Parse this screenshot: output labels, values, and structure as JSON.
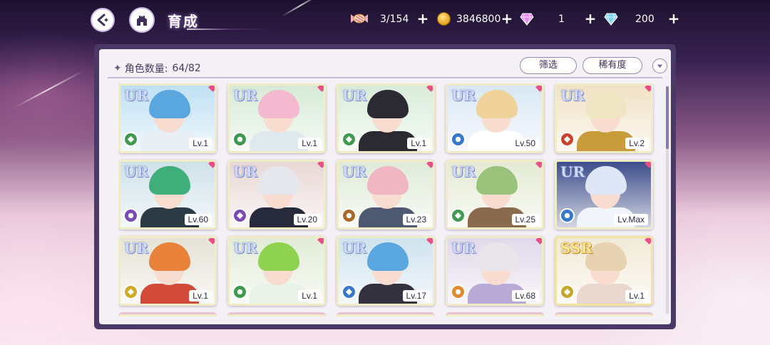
{
  "header": {
    "title": "育成",
    "resources": [
      {
        "name": "candy",
        "value": "3/154"
      },
      {
        "name": "coin",
        "value": "3846800"
      },
      {
        "name": "pink-gem",
        "value": "1"
      },
      {
        "name": "blue-gem",
        "value": "200"
      }
    ]
  },
  "panel": {
    "count_label": "角色数量:",
    "count_value": "64/82",
    "filter_label": "筛选",
    "sort_label": "稀有度"
  },
  "cards": [
    {
      "rarity": "UR",
      "level": "Lv.1",
      "hair": "#5aa7e0",
      "bg": "#bfe0f2",
      "body": "#e8eef4",
      "attr": "#3f9a4f"
    },
    {
      "rarity": "UR",
      "level": "Lv.1",
      "hair": "#f2b9cf",
      "bg": "#d6ead6",
      "body": "#dfe9ee",
      "attr": "#3f9a4f"
    },
    {
      "rarity": "UR",
      "level": "Lv.1",
      "hair": "#2b2a33",
      "bg": "#d8ecd9",
      "body": "#2a2a30",
      "attr": "#3f9a4f"
    },
    {
      "rarity": "UR",
      "level": "Lv.50",
      "hair": "#efd39a",
      "bg": "#d9e7f3",
      "body": "#ffffff",
      "attr": "#3678c9"
    },
    {
      "rarity": "UR",
      "level": "Lv.2",
      "hair": "#efe6c4",
      "bg": "#f1e2c6",
      "body": "#c99c3b",
      "attr": "#c8442f"
    },
    {
      "rarity": "UR",
      "level": "Lv.60",
      "hair": "#3fae7a",
      "bg": "#cfe1e8",
      "body": "#2c3a45",
      "attr": "#7a4bb4"
    },
    {
      "rarity": "UR",
      "level": "Lv.20",
      "hair": "#e6e7ec",
      "bg": "#e8d8d6",
      "body": "#272a3a",
      "attr": "#7a4bb4"
    },
    {
      "rarity": "UR",
      "level": "Lv.23",
      "hair": "#f0b7c3",
      "bg": "#dfead8",
      "body": "#4e5870",
      "attr": "#a8692c"
    },
    {
      "rarity": "UR",
      "level": "Lv.25",
      "hair": "#9ac27a",
      "bg": "#e5ead4",
      "body": "#8a6a4c",
      "attr": "#3f9a4f"
    },
    {
      "rarity": "UR",
      "level": "Lv.Max",
      "hair": "#dfe6f5",
      "bg": "#3c4c8a",
      "body": "#f2f4fb",
      "attr": "#3678c9"
    },
    {
      "rarity": "UR",
      "level": "Lv.1",
      "hair": "#e9823a",
      "bg": "#e5e3d6",
      "body": "#d24a3a",
      "attr": "#d1a828"
    },
    {
      "rarity": "UR",
      "level": "Lv.1",
      "hair": "#8fd24f",
      "bg": "#e2ecd7",
      "body": "#e9f2e6",
      "attr": "#3f9a4f"
    },
    {
      "rarity": "UR",
      "level": "Lv.17",
      "hair": "#5aa7e0",
      "bg": "#cfe3ee",
      "body": "#34323f",
      "attr": "#3678c9"
    },
    {
      "rarity": "UR",
      "level": "Lv.68",
      "hair": "#e8e6ea",
      "bg": "#e0d9ea",
      "body": "#b9a9d6",
      "attr": "#e08a2b"
    },
    {
      "rarity": "SSR",
      "level": "Lv.1",
      "hair": "#e7d2b2",
      "bg": "#f1ead7",
      "body": "#e9d7cf",
      "attr": "#c6a62a"
    }
  ],
  "colors": {
    "panel_frame": "#4a3966",
    "panel_bg": "#f3f0f6",
    "accent_pink": "#ea4e86"
  }
}
